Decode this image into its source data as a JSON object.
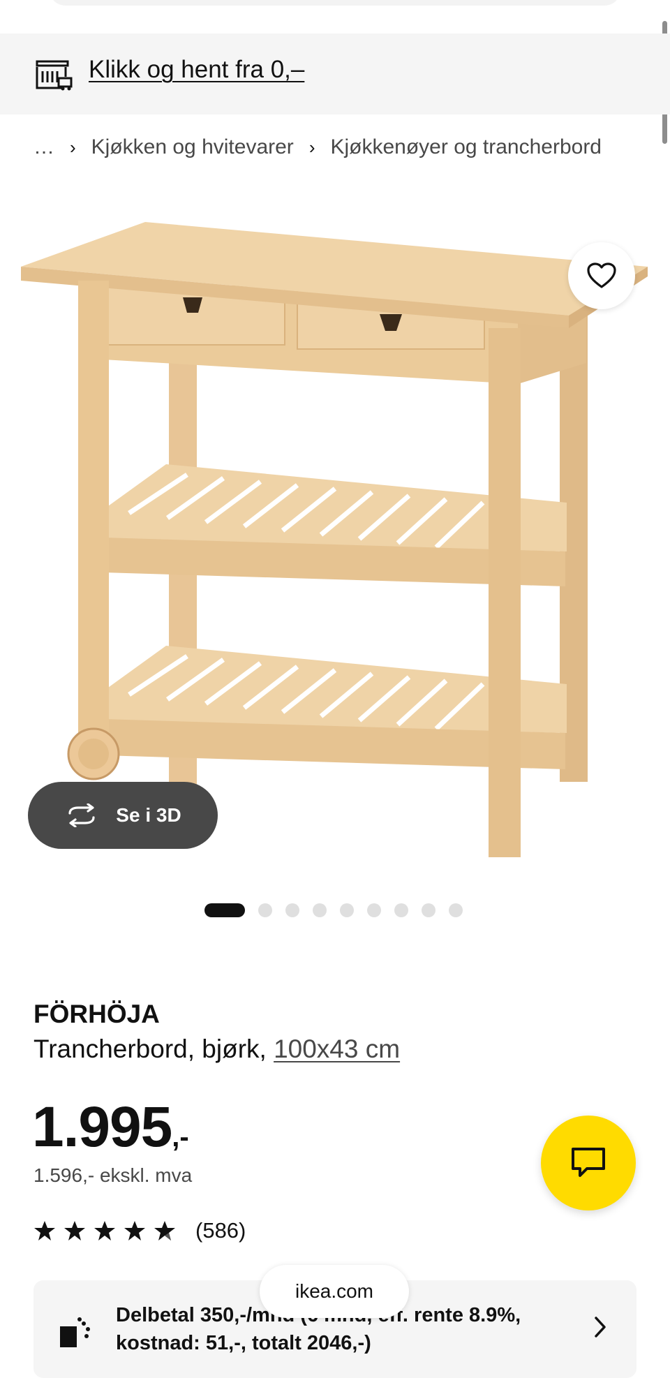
{
  "promo": {
    "link_text": "Klikk og hent fra 0,–",
    "icon": "store-pickup-icon"
  },
  "breadcrumb": {
    "items": [
      "…",
      "Kjøkken og hvitevarer",
      "Kjøkkenøyer og trancherbord"
    ],
    "separator": "›"
  },
  "gallery": {
    "view3d_label": "Se i 3D",
    "total_images": 9,
    "active_index": 0
  },
  "product": {
    "name": "FÖRHÖJA",
    "description": "Trancherbord, bjørk, ",
    "size": "100x43 cm",
    "price_main": "1.995",
    "price_suffix": ",-",
    "price_ex_vat": "1.596,- ekskl. mva",
    "rating": 5,
    "review_count": "(586)"
  },
  "finance": {
    "line1": "Delbetal 350,-/mnd (6 mnd, eff. rente 8.9%,",
    "line2": "kostnad: 51,-, totalt 2046,-)"
  },
  "browser": {
    "url": "ikea.com"
  },
  "colors": {
    "accent_yellow": "#ffdb00",
    "text": "#111111",
    "muted": "#484848",
    "wood": "#e9c89a"
  }
}
